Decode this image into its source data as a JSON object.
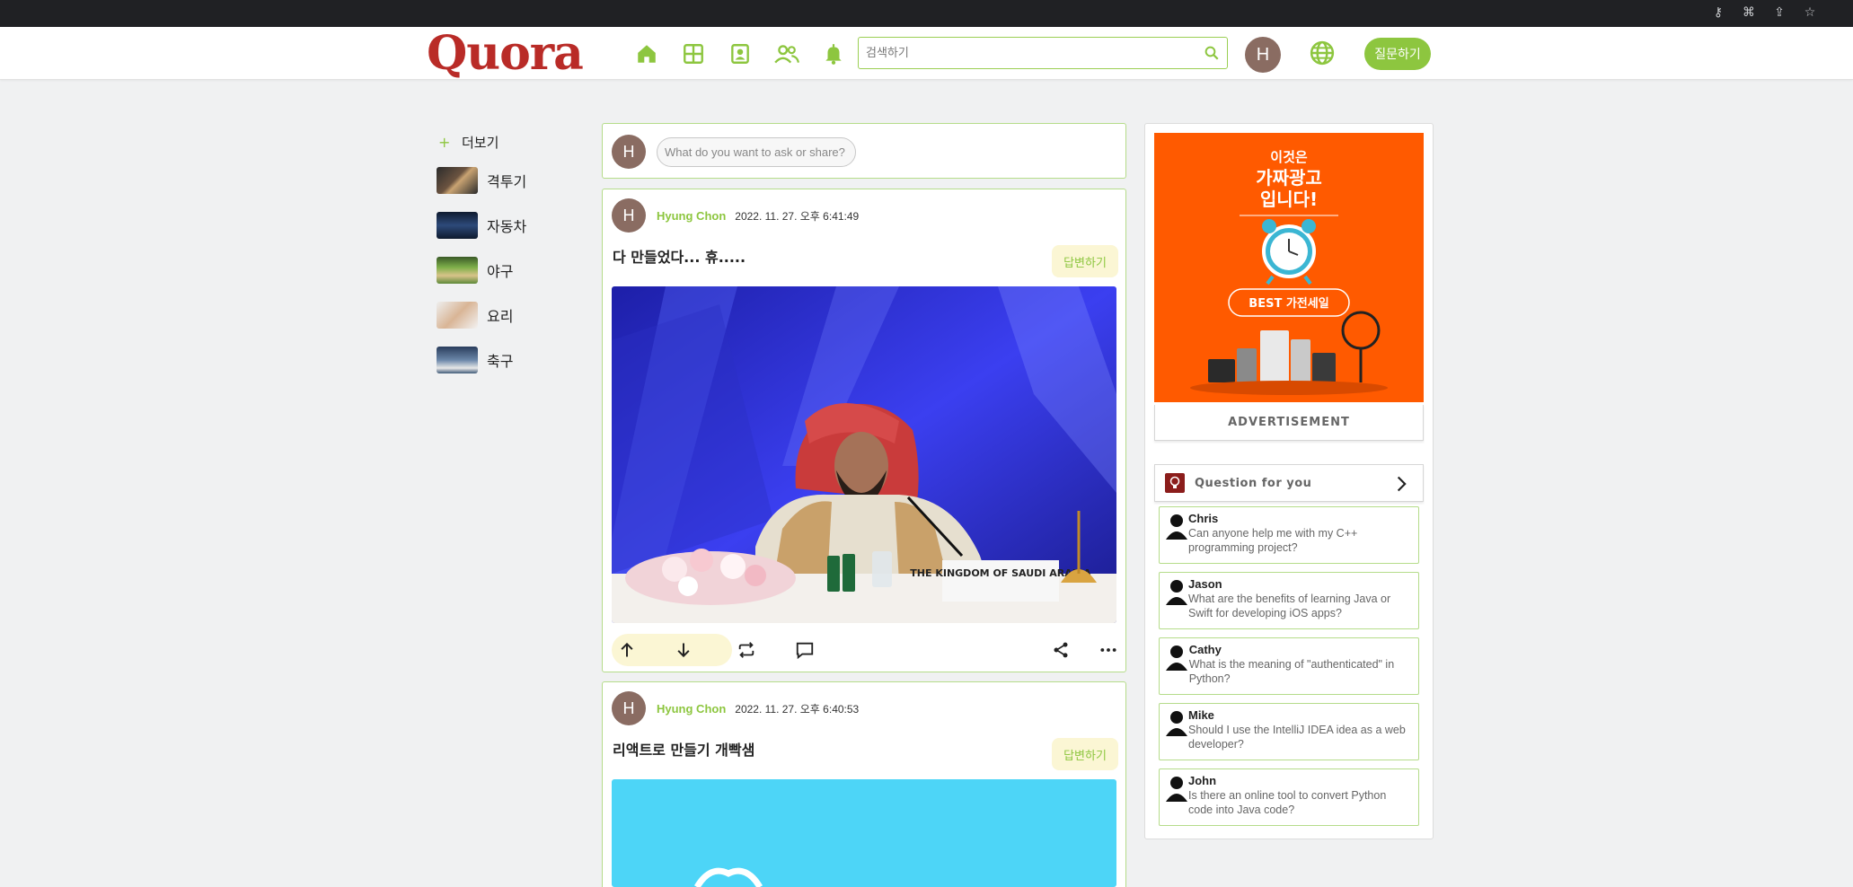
{
  "header": {
    "logo": "Quora",
    "search_placeholder": "검색하기",
    "user_initial": "H",
    "ask_button": "질문하기"
  },
  "sidebar": {
    "more_label": "더보기",
    "topics": [
      {
        "label": "격투기",
        "thumb_color": "#5a4a3a"
      },
      {
        "label": "자동차",
        "thumb_color": "#1f2f4a"
      },
      {
        "label": "야구",
        "thumb_color": "#5e8a3a"
      },
      {
        "label": "요리",
        "thumb_color": "#c9a98c"
      },
      {
        "label": "축구",
        "thumb_color": "#3f5a78"
      }
    ]
  },
  "feed": {
    "ask_initial": "H",
    "ask_placeholder": "What do you want to ask or share?",
    "posts": [
      {
        "initial": "H",
        "author": "Hyung Chon",
        "timestamp": "2022. 11. 27. 오후 6:41:49",
        "title": "다 만들었다... 휴.....",
        "answer_label": "답변하기",
        "image_sign": "THE KINGDOM OF SAUDI ARABIA"
      },
      {
        "initial": "H",
        "author": "Hyung Chon",
        "timestamp": "2022. 11. 27. 오후 6:40:53",
        "title": "리액트로 만들기 개빡샘",
        "answer_label": "답변하기"
      }
    ]
  },
  "ad": {
    "line1": "이것은",
    "line2": "가짜광고",
    "line3": "입니다!",
    "badge": "BEST 가전세일",
    "label": "ADVERTISEMENT",
    "bg": "#ff5a00"
  },
  "questions": {
    "title": "Question for you",
    "items": [
      {
        "name": "Chris",
        "text": "Can anyone help me with my C++ programming project?"
      },
      {
        "name": "Jason",
        "text": "What are the benefits of learning Java or Swift for developing iOS apps?"
      },
      {
        "name": "Cathy",
        "text": "What is the meaning of \"authenticated\" in Python?"
      },
      {
        "name": "Mike",
        "text": "Should I use the IntelliJ IDEA idea as a web developer?"
      },
      {
        "name": "John",
        "text": "Is there an online tool to convert Python code into Java code?"
      }
    ]
  },
  "colors": {
    "brand": "#b92b27",
    "accent": "#8dc63f",
    "answer_bg": "#fbf6d4"
  }
}
